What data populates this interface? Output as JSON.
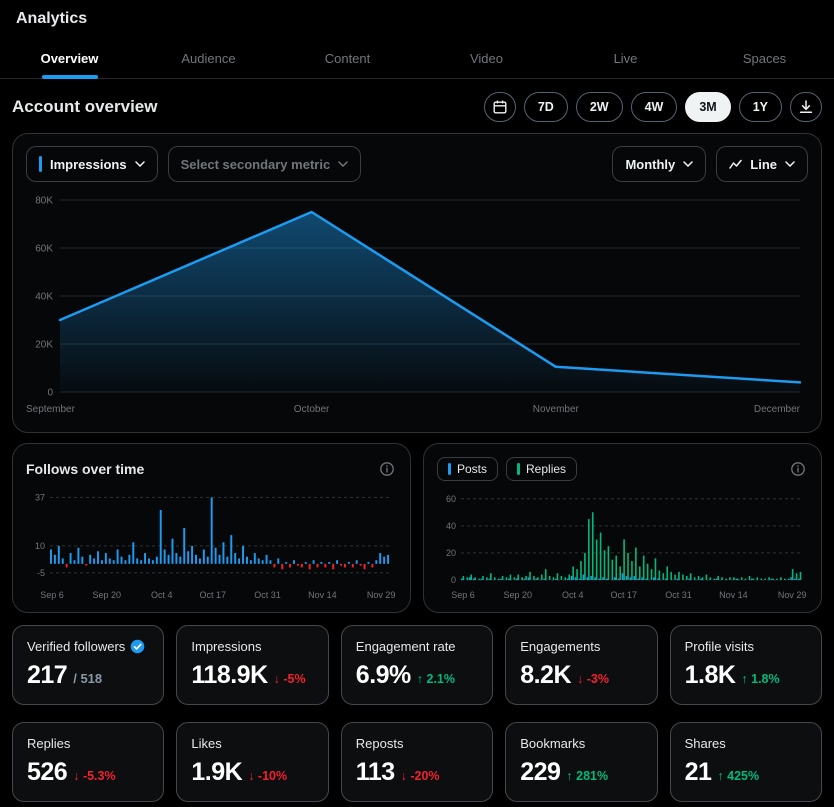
{
  "header": {
    "title": "Analytics"
  },
  "tabs": [
    {
      "label": "Overview",
      "active": true
    },
    {
      "label": "Audience",
      "active": false
    },
    {
      "label": "Content",
      "active": false
    },
    {
      "label": "Video",
      "active": false
    },
    {
      "label": "Live",
      "active": false
    },
    {
      "label": "Spaces",
      "active": false
    }
  ],
  "section": {
    "title": "Account overview"
  },
  "ranges": [
    "7D",
    "2W",
    "4W",
    "3M",
    "1Y"
  ],
  "range_selected": "3M",
  "controls": {
    "primary_metric": "Impressions",
    "secondary_metric_placeholder": "Select secondary metric",
    "interval": "Monthly",
    "chart_type": "Line"
  },
  "icons": [
    "calendar-icon",
    "download-icon",
    "chevron-down-icon",
    "line-chart-icon",
    "info-icon",
    "verified-badge-icon"
  ],
  "colors": {
    "accent_blue": "#1d9bf0",
    "positive_green": "#00ba7c",
    "negative_red": "#f4212e",
    "muted_text": "#71767b",
    "border": "#2f3336"
  },
  "cards": {
    "follows": {
      "title": "Follows over time"
    },
    "posts_replies": {
      "legend": [
        {
          "label": "Posts",
          "color": "#1d9bf0"
        },
        {
          "label": "Replies",
          "color": "#00ba7c"
        }
      ]
    }
  },
  "chart_data": [
    {
      "type": "line",
      "title": "Impressions over time",
      "x": [
        "September",
        "October",
        "November",
        "December"
      ],
      "x_fractions": [
        0,
        0.34,
        0.67,
        1
      ],
      "values": [
        30000,
        75000,
        10500,
        4000
      ],
      "yticks": [
        0,
        20000,
        40000,
        60000,
        80000
      ],
      "ytick_labels": [
        "0",
        "20K",
        "40K",
        "60K",
        "80K"
      ],
      "ylim": [
        0,
        80000
      ],
      "line_color": "#1d9bf0",
      "grid": true,
      "legend_position": "none"
    },
    {
      "type": "bar",
      "title": "Follows over time",
      "values": [
        8,
        5,
        10,
        3,
        -2,
        6,
        2,
        9,
        4,
        -1,
        5,
        3,
        7,
        2,
        6,
        3,
        2,
        8,
        4,
        2,
        5,
        12,
        3,
        2,
        6,
        3,
        2,
        4,
        30,
        8,
        5,
        14,
        6,
        4,
        20,
        7,
        10,
        5,
        3,
        8,
        4,
        37,
        9,
        5,
        12,
        4,
        16,
        6,
        3,
        10,
        4,
        2,
        6,
        3,
        2,
        5,
        2,
        -2,
        3,
        -3,
        1,
        -2,
        2,
        -1,
        -2,
        1,
        -3,
        2,
        -2,
        1,
        -2,
        1,
        -3,
        2,
        -1,
        -2,
        1,
        -2,
        2,
        -1,
        -3,
        1,
        -2,
        2,
        6,
        4,
        5
      ],
      "yticks": [
        37,
        10,
        -5
      ],
      "ylim": [
        -9,
        40
      ],
      "x_labels": [
        {
          "index": 0,
          "label": "Sep 6"
        },
        {
          "index": 14,
          "label": "Sep 20"
        },
        {
          "index": 28,
          "label": "Oct 4"
        },
        {
          "index": 41,
          "label": "Oct 17"
        },
        {
          "index": 55,
          "label": "Oct 31"
        },
        {
          "index": 69,
          "label": "Nov 14"
        },
        {
          "index": 84,
          "label": "Nov 29"
        }
      ],
      "positive_color": "#1d9bf0",
      "negative_color": "#f4212e",
      "grid": true
    },
    {
      "type": "grouped_bar",
      "title": "Posts and Replies over time",
      "series": [
        {
          "name": "Posts",
          "color": "#1d9bf0",
          "values": [
            1,
            0,
            2,
            1,
            0,
            1,
            0,
            1,
            0,
            0,
            1,
            0,
            1,
            0,
            1,
            0,
            1,
            2,
            0,
            1,
            0,
            1,
            0,
            0,
            1,
            0,
            0,
            1,
            3,
            2,
            1,
            4,
            2,
            3,
            2,
            1,
            2,
            1,
            0,
            2,
            1,
            5,
            3,
            2,
            3,
            1,
            2,
            1,
            0,
            2,
            1,
            0,
            1,
            0,
            0,
            1,
            0,
            0,
            1,
            0,
            0,
            1,
            0,
            0,
            0,
            1,
            0,
            0,
            0,
            0,
            1,
            0,
            0,
            0,
            1,
            0,
            0,
            0,
            0,
            1,
            0,
            0,
            0,
            0,
            2,
            1,
            1
          ]
        },
        {
          "name": "Replies",
          "color": "#00ba7c",
          "values": [
            3,
            2,
            4,
            2,
            1,
            3,
            2,
            5,
            2,
            1,
            3,
            2,
            4,
            2,
            4,
            2,
            3,
            6,
            3,
            2,
            4,
            8,
            3,
            2,
            5,
            3,
            2,
            4,
            10,
            8,
            14,
            20,
            45,
            50,
            30,
            35,
            22,
            25,
            15,
            18,
            10,
            30,
            20,
            14,
            24,
            10,
            18,
            12,
            8,
            16,
            7,
            5,
            10,
            6,
            4,
            6,
            4,
            3,
            5,
            2,
            3,
            2,
            4,
            2,
            1,
            3,
            2,
            1,
            2,
            2,
            1,
            2,
            1,
            3,
            1,
            2,
            1,
            1,
            2,
            1,
            1,
            2,
            1,
            1,
            8,
            5,
            6
          ]
        }
      ],
      "yticks": [
        60,
        40,
        20,
        0
      ],
      "ylim": [
        0,
        65
      ],
      "x_labels": [
        {
          "index": 0,
          "label": "Sep 6"
        },
        {
          "index": 14,
          "label": "Sep 20"
        },
        {
          "index": 28,
          "label": "Oct 4"
        },
        {
          "index": 41,
          "label": "Oct 17"
        },
        {
          "index": 55,
          "label": "Oct 31"
        },
        {
          "index": 69,
          "label": "Nov 14"
        },
        {
          "index": 84,
          "label": "Nov 29"
        }
      ],
      "grid": true,
      "legend_position": "top-left"
    }
  ],
  "metrics_row1": [
    {
      "label": "Verified followers",
      "value": "217",
      "suffix": "/ 518"
    },
    {
      "label": "Impressions",
      "value": "118.9K",
      "delta": "↓ -5%",
      "dir": "down"
    },
    {
      "label": "Engagement rate",
      "value": "6.9%",
      "delta": "↑ 2.1%",
      "dir": "up"
    },
    {
      "label": "Engagements",
      "value": "8.2K",
      "delta": "↓ -3%",
      "dir": "down"
    },
    {
      "label": "Profile visits",
      "value": "1.8K",
      "delta": "↑ 1.8%",
      "dir": "up"
    }
  ],
  "metrics_row2": [
    {
      "label": "Replies",
      "value": "526",
      "delta": "↓ -5.3%",
      "dir": "down"
    },
    {
      "label": "Likes",
      "value": "1.9K",
      "delta": "↓ -10%",
      "dir": "down"
    },
    {
      "label": "Reposts",
      "value": "113",
      "delta": "↓ -20%",
      "dir": "down"
    },
    {
      "label": "Bookmarks",
      "value": "229",
      "delta": "↑ 281%",
      "dir": "up"
    },
    {
      "label": "Shares",
      "value": "21",
      "delta": "↑ 425%",
      "dir": "up"
    }
  ]
}
